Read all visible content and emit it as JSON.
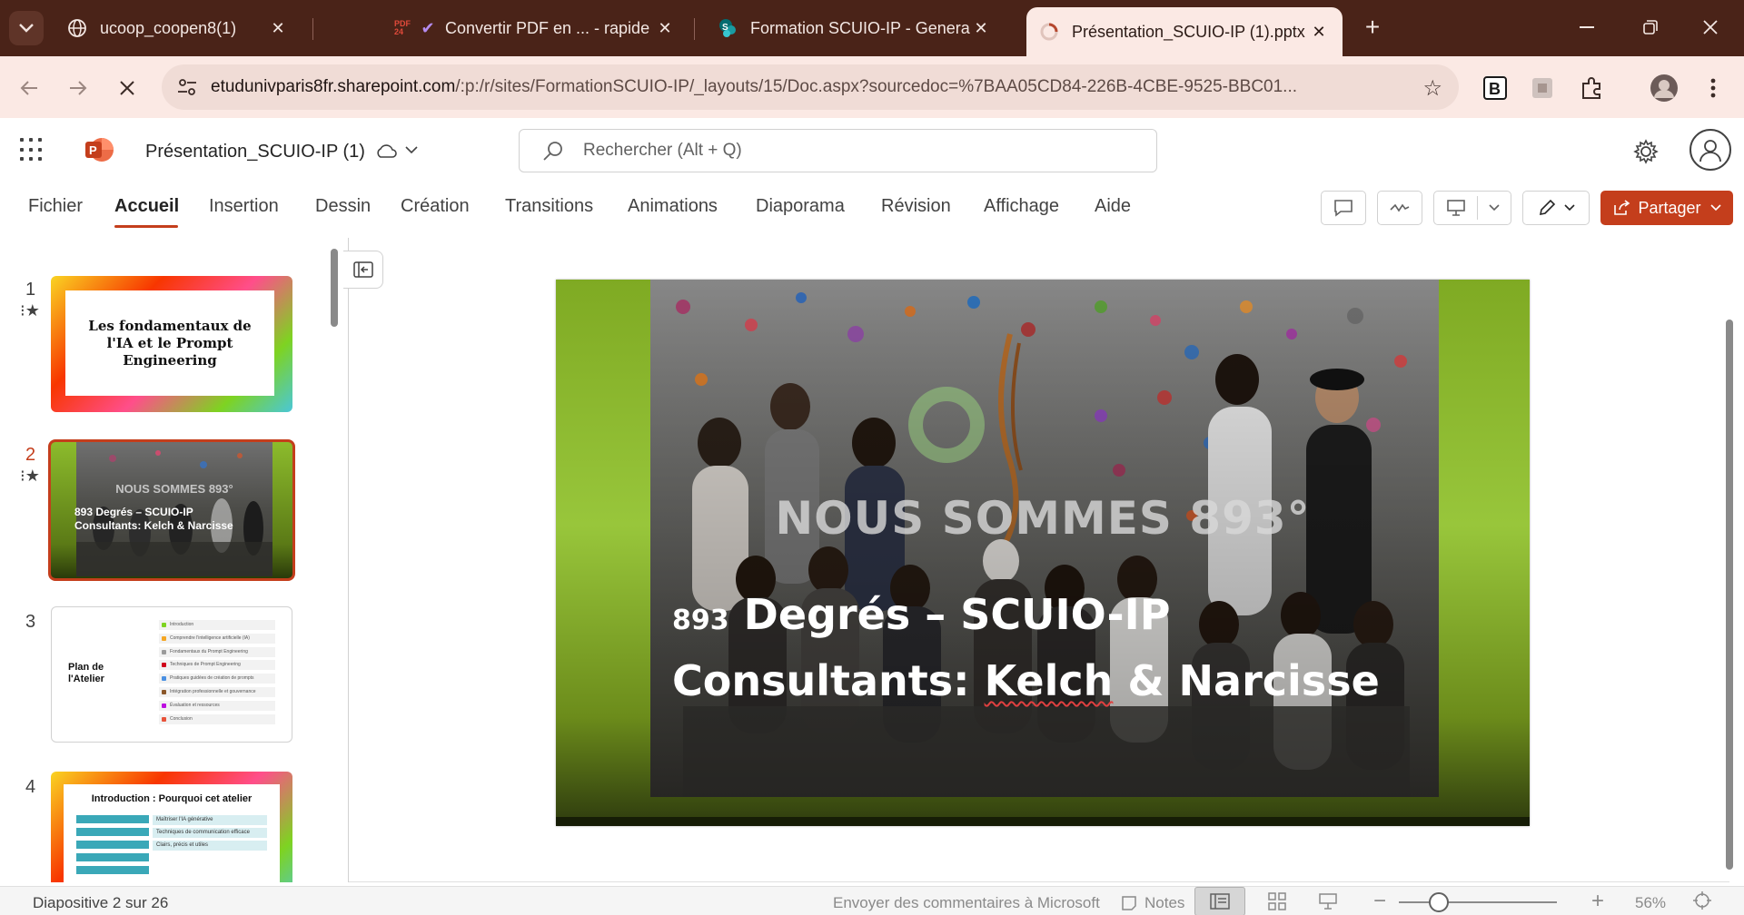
{
  "browser": {
    "tabs": [
      {
        "title": "ucoop_coopen8(1)",
        "favicon": "globe-icon"
      },
      {
        "title": "Convertir PDF en ... - rapide",
        "favicon": "pdf24-icon"
      },
      {
        "title": "Formation SCUIO-IP - General -",
        "favicon": "sharepoint-icon"
      },
      {
        "title": "Présentation_SCUIO-IP (1).pptx",
        "favicon": "loading-icon"
      }
    ],
    "url_host": "etudunivparis8fr.sharepoint.com",
    "url_path": "/:p:/r/sites/FormationSCUIO-IP/_layouts/15/Doc.aspx?sourcedoc=%7BAA05CD84-226B-4CBE-9525-BBC01..."
  },
  "app": {
    "document_title": "Présentation_SCUIO-IP (1)",
    "search_placeholder": "Rechercher (Alt + Q)"
  },
  "ribbon": {
    "tabs": [
      "Fichier",
      "Accueil",
      "Insertion",
      "Dessin",
      "Création",
      "Transitions",
      "Animations",
      "Diaporama",
      "Révision",
      "Affichage",
      "Aide"
    ],
    "active_tab": "Accueil",
    "share_label": "Partager"
  },
  "thumbnails": [
    {
      "number": "1",
      "title": "Les fondamentaux de l'IA et le Prompt Engineering"
    },
    {
      "number": "2",
      "heading": "NOUS SOMMES 893°",
      "title_line1": "893 Degrés – SCUIO-IP",
      "title_line2": "Consultants: Kelch & Narcisse"
    },
    {
      "number": "3",
      "title_line1": "Plan de",
      "title_line2": "l'Atelier",
      "items": [
        "Introduction",
        "Comprendre l'intelligence artificielle (IA)",
        "Fondamentaux du Prompt Engineering",
        "Techniques de Prompt Engineering",
        "Pratiques guidées de création de prompts",
        "Intégration professionnelle et gouvernance",
        "Évaluation et ressources",
        "Conclusion"
      ]
    },
    {
      "number": "4",
      "title": "Introduction : Pourquoi cet atelier",
      "bullets": [
        "Maîtriser l'IA générative",
        "Techniques de communication efficace",
        "Clairs, précis et utiles"
      ]
    }
  ],
  "slide": {
    "heading": "NOUS SOMMES 893°",
    "title_line1_prefix": "893",
    "title_line1_rest": "Degrés – SCUIO-IP",
    "title_line2_a": "Consultants:",
    "title_line2_b": "Kelch",
    "title_line2_c": "& Narcisse"
  },
  "status": {
    "slide_counter": "Diapositive 2 sur 26",
    "feedback": "Envoyer des commentaires à Microsoft",
    "notes_label": "Notes",
    "zoom": "56%"
  },
  "colors": {
    "accent": "#c43e1c",
    "browser_frame": "#4a2318",
    "browser_toolbar": "#fbe9e4",
    "slide_green": "#98c63b"
  }
}
